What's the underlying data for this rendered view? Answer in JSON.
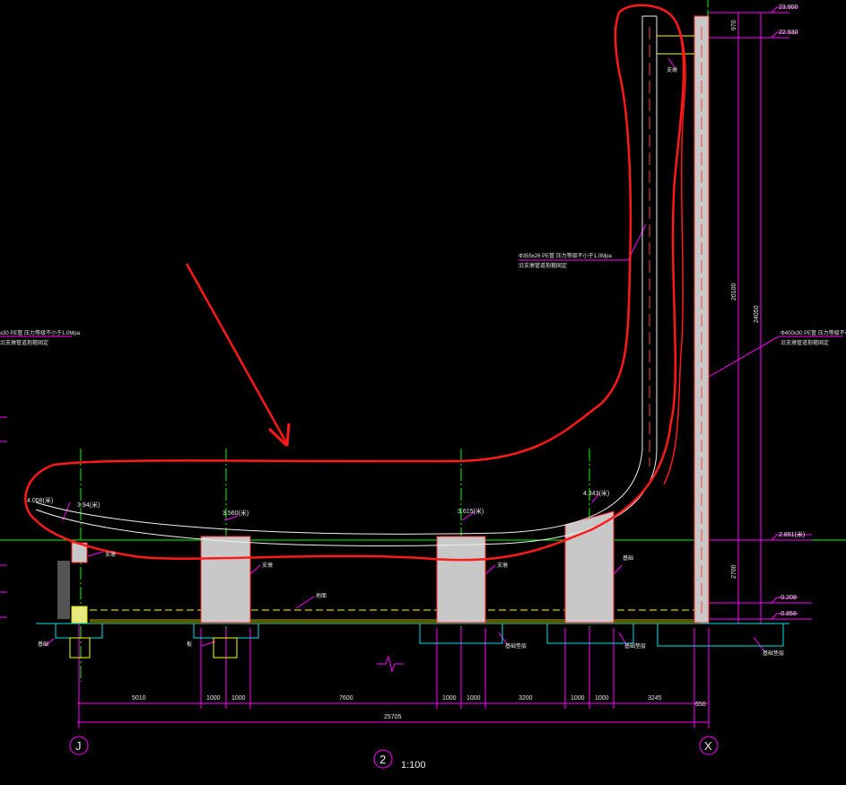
{
  "drawing": {
    "elevations": {
      "top": "23.900",
      "second": "22.930",
      "platform": "2.851(米)",
      "ground1": "-0.208",
      "ground2": "-0.858"
    },
    "vertical_dims": {
      "d970": "970",
      "d20100": "20100",
      "d24050": "24050",
      "d2700": "2700"
    },
    "horizontal_dims": [
      "5010",
      "1000",
      "1000",
      "7600",
      "1000",
      "1000",
      "3200",
      "1000",
      "1000",
      "3245"
    ],
    "dim_650": "650",
    "total_span": "25705",
    "point_labels": {
      "p1": "4.008(米)",
      "p2": "3.94(米)",
      "p3": "3.560(米)",
      "p4": "3.615(米)",
      "p5": "4.343(米)"
    },
    "pipe_note_main_1": "Φ355x26 PE管 压力等级不小于1.0Mpa",
    "pipe_note_main_2": "沿支墩管道抱箍固定",
    "pipe_note_right_1": "Φ400x30 PE管 压力等级不小于",
    "pipe_note_right_2": "沿支墩管道抱箍固定",
    "pipe_note_left_1": "x30 PE管 压力等级不小于1.0Mpa",
    "pipe_note_left_2": "沿支墩管道抱箍固定",
    "labels": {
      "pier": "支墩",
      "ground": "地面",
      "top_block": "支墩",
      "found": "基础",
      "base": "基础",
      "block_l": "支墩",
      "block_r": "支墩",
      "bottom_found1": "基础垫层",
      "bottom_found2": "基础垫层",
      "bottom_found3": "基础垫层",
      "small": "板"
    },
    "axis_left": "J",
    "axis_right": "X",
    "axis_mid": "2",
    "scale": "1:100"
  }
}
